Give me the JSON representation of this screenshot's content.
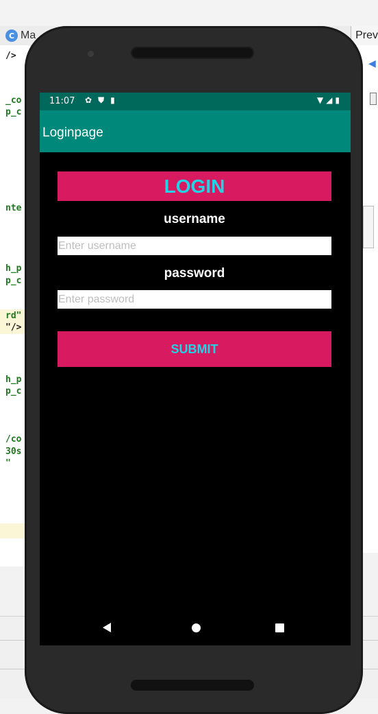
{
  "ide": {
    "left_tab_label": "Ma",
    "right_tab_label": "Prev",
    "code_fragments": [
      "/>",
      "_co",
      "p_c",
      "nte",
      "h_p",
      "p_c",
      "rd\"",
      "\"/>",
      "h_p",
      "p_c",
      "/co",
      "30s",
      "\""
    ]
  },
  "status_bar": {
    "time": "11:07",
    "left_icons": [
      "gear-icon",
      "shield-icon",
      "sd-card-icon"
    ],
    "right_icons": [
      "wifi-icon",
      "signal-icon",
      "battery-icon"
    ]
  },
  "app_bar": {
    "title": "Loginpage"
  },
  "login": {
    "banner_text": "LOGIN",
    "username_label": "username",
    "username_placeholder": "Enter username",
    "username_value": "",
    "password_label": "password",
    "password_placeholder": "Enter password",
    "password_value": "",
    "submit_label": "SUBMIT"
  },
  "nav_bar": {
    "buttons": [
      "back-icon",
      "home-icon",
      "recents-icon"
    ]
  },
  "colors": {
    "status_bar": "#00695c",
    "app_bar": "#00897b",
    "accent_pink": "#d81b60",
    "accent_cyan": "#22d3e6",
    "screen_bg": "#000000"
  }
}
